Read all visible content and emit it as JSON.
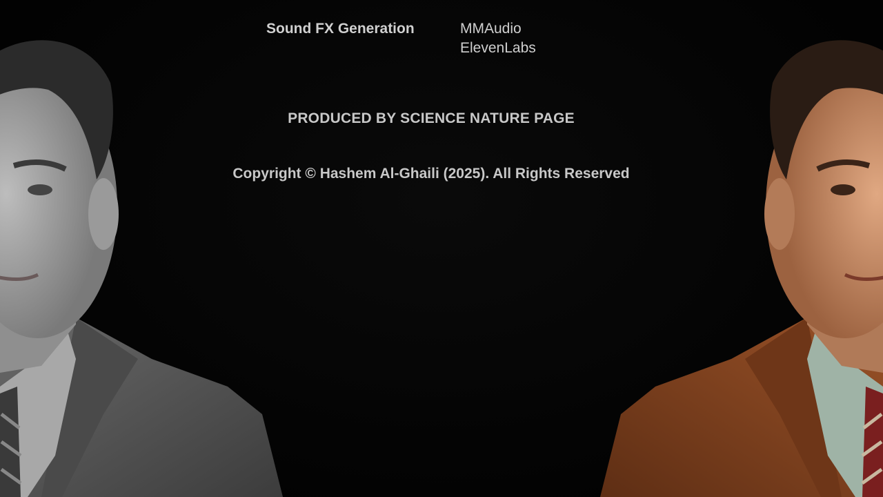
{
  "credits": {
    "role": "Sound FX Generation",
    "names": [
      "MMAudio",
      "ElevenLabs"
    ]
  },
  "producer_line": "PRODUCED BY SCIENCE NATURE PAGE",
  "copyright_line": "Copyright © Hashem Al-Ghaili (2025). All Rights Reserved",
  "colors": {
    "background": "#000000",
    "text": "#c8c8c8",
    "left_suit": "#5a5a5a",
    "right_suit": "#8a4a24"
  }
}
